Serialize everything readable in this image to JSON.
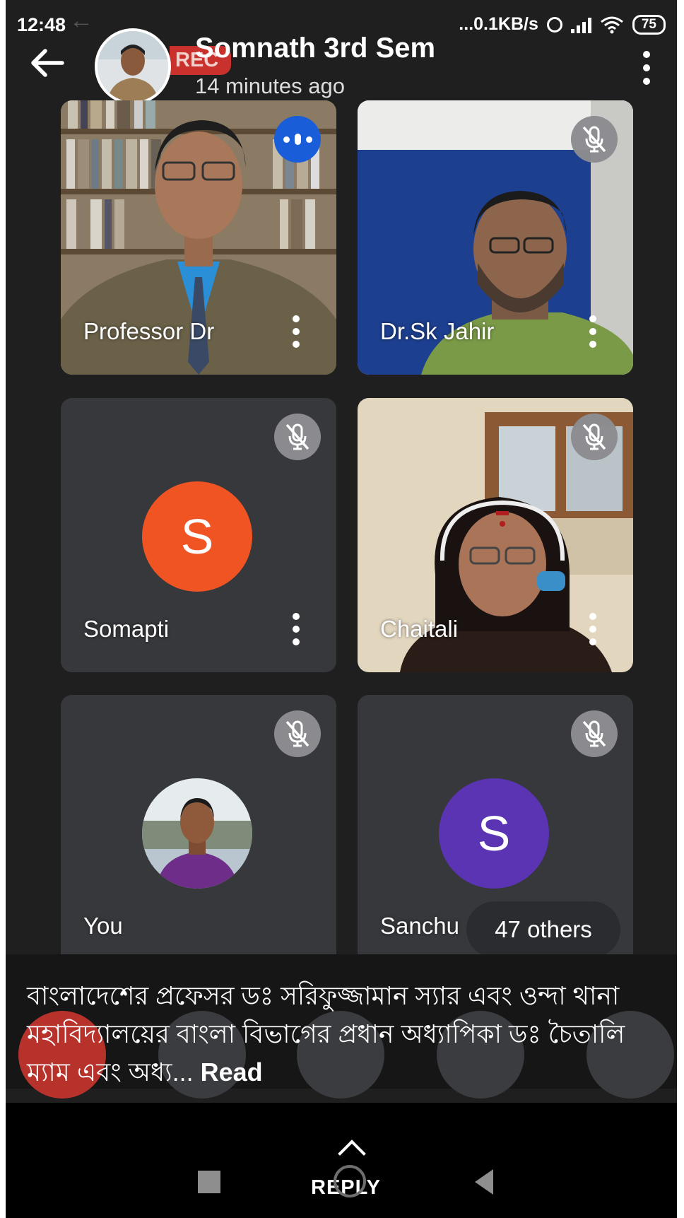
{
  "status_bar": {
    "time": "12:48",
    "network_speed": "...0.1KB/s",
    "battery": "75"
  },
  "header": {
    "rec_label": "REC",
    "title": "Somnath 3rd Sem",
    "subtitle": "14 minutes ago"
  },
  "tiles": [
    {
      "name": "Professor Dr",
      "state": "speaking"
    },
    {
      "name": "Dr.Sk Jahir",
      "state": "muted"
    },
    {
      "name": "Somapti",
      "state": "muted",
      "avatar_letter": "S",
      "avatar_color": "#f05423"
    },
    {
      "name": "Chaitali",
      "state": "muted"
    },
    {
      "name": "You",
      "state": "muted"
    },
    {
      "name": "Sanchu",
      "state": "muted",
      "avatar_letter": "S",
      "avatar_color": "#5b34b4"
    }
  ],
  "others_label": "47 others",
  "caption": {
    "text": "বাংলাদেশের প্রফেসর ডঃ সরিফুজ্জামান স্যার এবং ওন্দা থানা মহাবিদ্যালয়ের বাংলা বিভাগের প্রধান অধ্যাপিকা ডঃ চৈতালি ম্যাম এবং অধ্য...",
    "read_more": "Read"
  },
  "reply_label": "REPLY",
  "colors": {
    "tile_bg": "#37383c",
    "speaking_badge": "#1a5dd8",
    "rec_badge": "#c9322c",
    "end_call": "#b8322c"
  }
}
